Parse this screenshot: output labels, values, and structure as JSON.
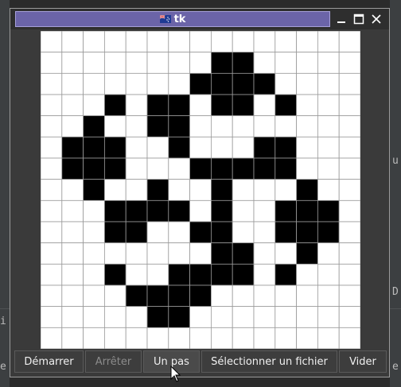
{
  "window": {
    "title": "tk",
    "controls": [
      "minimize",
      "maximize",
      "close"
    ]
  },
  "background": {
    "code_fragment": "...",
    "right_glyph_1": "u",
    "right_glyph_2": "D",
    "left_glyph_1": "i",
    "left_glyph_2": "e",
    "right_glyph_3": "e"
  },
  "grid": {
    "rows": 15,
    "cols": 15,
    "alive_color": "#000000",
    "dead_color": "#ffffff",
    "line_color": "#9a9a9a",
    "alive_cells": [
      [
        1,
        8
      ],
      [
        1,
        9
      ],
      [
        2,
        7
      ],
      [
        2,
        8
      ],
      [
        2,
        9
      ],
      [
        2,
        10
      ],
      [
        3,
        3
      ],
      [
        3,
        5
      ],
      [
        3,
        6
      ],
      [
        3,
        8
      ],
      [
        3,
        9
      ],
      [
        3,
        11
      ],
      [
        4,
        2
      ],
      [
        4,
        5
      ],
      [
        4,
        6
      ],
      [
        5,
        1
      ],
      [
        5,
        2
      ],
      [
        5,
        3
      ],
      [
        5,
        6
      ],
      [
        5,
        10
      ],
      [
        5,
        11
      ],
      [
        6,
        1
      ],
      [
        6,
        2
      ],
      [
        6,
        3
      ],
      [
        6,
        7
      ],
      [
        6,
        8
      ],
      [
        6,
        9
      ],
      [
        6,
        10
      ],
      [
        6,
        11
      ],
      [
        7,
        2
      ],
      [
        7,
        5
      ],
      [
        7,
        8
      ],
      [
        7,
        12
      ],
      [
        8,
        3
      ],
      [
        8,
        4
      ],
      [
        8,
        5
      ],
      [
        8,
        6
      ],
      [
        8,
        8
      ],
      [
        8,
        11
      ],
      [
        8,
        12
      ],
      [
        8,
        13
      ],
      [
        9,
        3
      ],
      [
        9,
        4
      ],
      [
        9,
        7
      ],
      [
        9,
        8
      ],
      [
        9,
        11
      ],
      [
        9,
        12
      ],
      [
        9,
        13
      ],
      [
        10,
        8
      ],
      [
        10,
        9
      ],
      [
        10,
        12
      ],
      [
        11,
        3
      ],
      [
        11,
        6
      ],
      [
        11,
        7
      ],
      [
        11,
        8
      ],
      [
        11,
        9
      ],
      [
        11,
        11
      ],
      [
        12,
        4
      ],
      [
        12,
        5
      ],
      [
        12,
        6
      ],
      [
        12,
        7
      ],
      [
        13,
        5
      ],
      [
        13,
        6
      ]
    ]
  },
  "buttons": {
    "start": "Démarrer",
    "stop": "Arrêter",
    "step": "Un pas",
    "select_file": "Sélectionner un fichier",
    "clear": "Vider"
  }
}
